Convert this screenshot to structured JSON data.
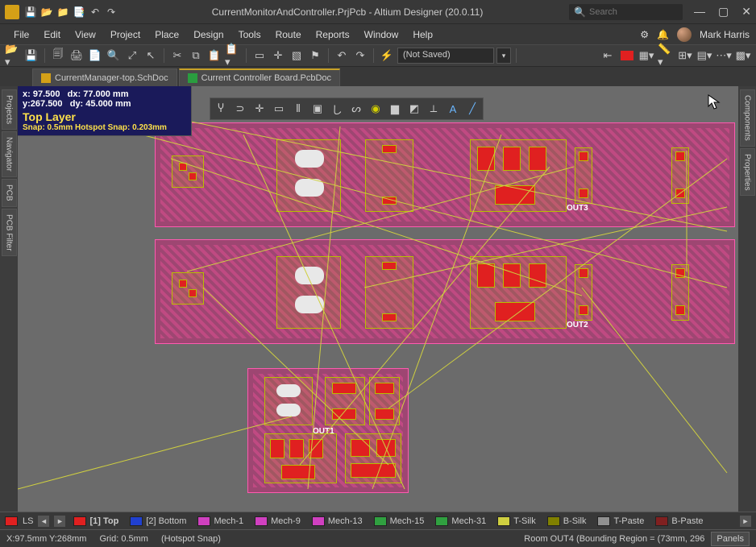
{
  "title": "CurrentMonitorAndController.PrjPcb - Altium Designer (20.0.11)",
  "search": {
    "placeholder": "Search"
  },
  "menus": [
    "File",
    "Edit",
    "View",
    "Project",
    "Place",
    "Design",
    "Tools",
    "Route",
    "Reports",
    "Window",
    "Help"
  ],
  "user": {
    "name": "Mark Harris"
  },
  "toolbar": {
    "saved": "(Not Saved)"
  },
  "tabs": [
    {
      "label": "CurrentManager-top.SchDoc",
      "kind": "sch",
      "active": false
    },
    {
      "label": "Current Controller Board.PcbDoc",
      "kind": "pcb",
      "active": true
    }
  ],
  "left_rail": [
    "Projects",
    "Navigator",
    "PCB",
    "PCB Filter"
  ],
  "right_rail": [
    "Components",
    "Properties"
  ],
  "hud": {
    "x": "x: 97.500",
    "dx": "dx: 77.000  mm",
    "y": "y:267.500",
    "dy": "dy: 45.000  mm",
    "layer": "Top Layer",
    "snap": "Snap: 0.5mm Hotspot Snap: 0.203mm"
  },
  "designators": {
    "out1": "OUT1",
    "out2": "OUT2",
    "out3": "OUT3"
  },
  "layer_tabs": {
    "ls_label": "LS",
    "items": [
      {
        "label": "[1] Top",
        "color": "#e02020",
        "active": true
      },
      {
        "label": "[2] Bottom",
        "color": "#2040d0"
      },
      {
        "label": "Mech-1",
        "color": "#d040c0"
      },
      {
        "label": "Mech-9",
        "color": "#d040c0"
      },
      {
        "label": "Mech-13",
        "color": "#d040c0"
      },
      {
        "label": "Mech-15",
        "color": "#30a040"
      },
      {
        "label": "Mech-31",
        "color": "#30a040"
      },
      {
        "label": "T-Silk",
        "color": "#cfcf40"
      },
      {
        "label": "B-Silk",
        "color": "#808000"
      },
      {
        "label": "T-Paste",
        "color": "#909090"
      },
      {
        "label": "B-Paste",
        "color": "#802020"
      }
    ]
  },
  "status": {
    "coords": "X:97.5mm Y:268mm",
    "grid": "Grid: 0.5mm",
    "snap": "(Hotspot Snap)",
    "cfg": "Room OUT4 (Bounding Region = (73mm, 296",
    "panels": "Panels"
  }
}
